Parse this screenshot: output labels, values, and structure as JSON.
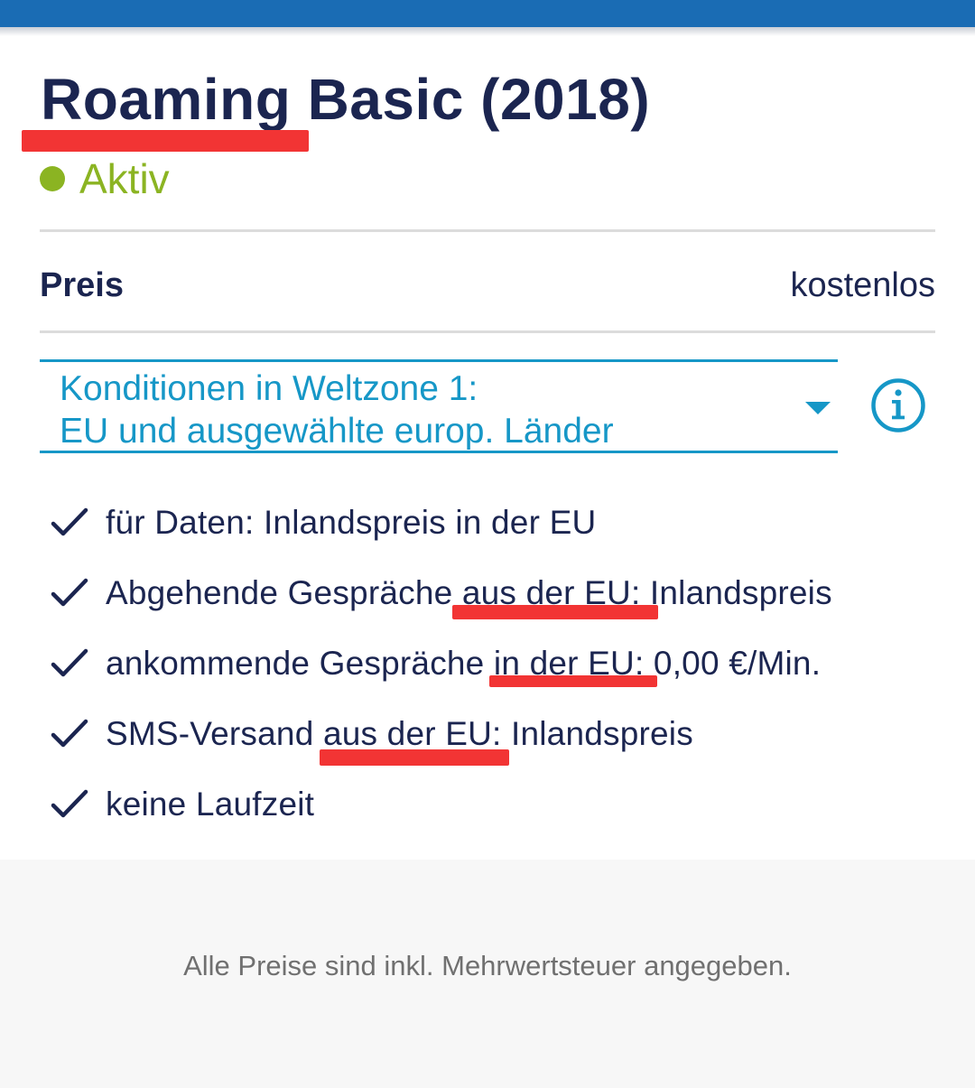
{
  "header": {
    "title": "Roaming Basic (2018)",
    "status": "Aktiv",
    "status_color": "#8bb422",
    "bar_color": "#1a6cb4"
  },
  "price": {
    "label": "Preis",
    "value": "kostenlos"
  },
  "zone_select": {
    "selected_line1": "Konditionen in Weltzone 1:",
    "selected_line2": "EU und ausgewählte europ. Länder",
    "accent_color": "#1697c7",
    "info_icon": "info-icon"
  },
  "features": [
    "für Daten: Inlandspreis in der EU",
    "Abgehende Gespräche aus der EU: Inlandspreis",
    "ankommende Gespräche in der EU: 0,00 €/Min.",
    "SMS-Versand aus der EU: Inlandspreis",
    "keine Laufzeit"
  ],
  "annotation_color": "#f23434",
  "footer": {
    "note": "Alle Preise sind inkl. Mehrwertsteuer angegeben."
  }
}
